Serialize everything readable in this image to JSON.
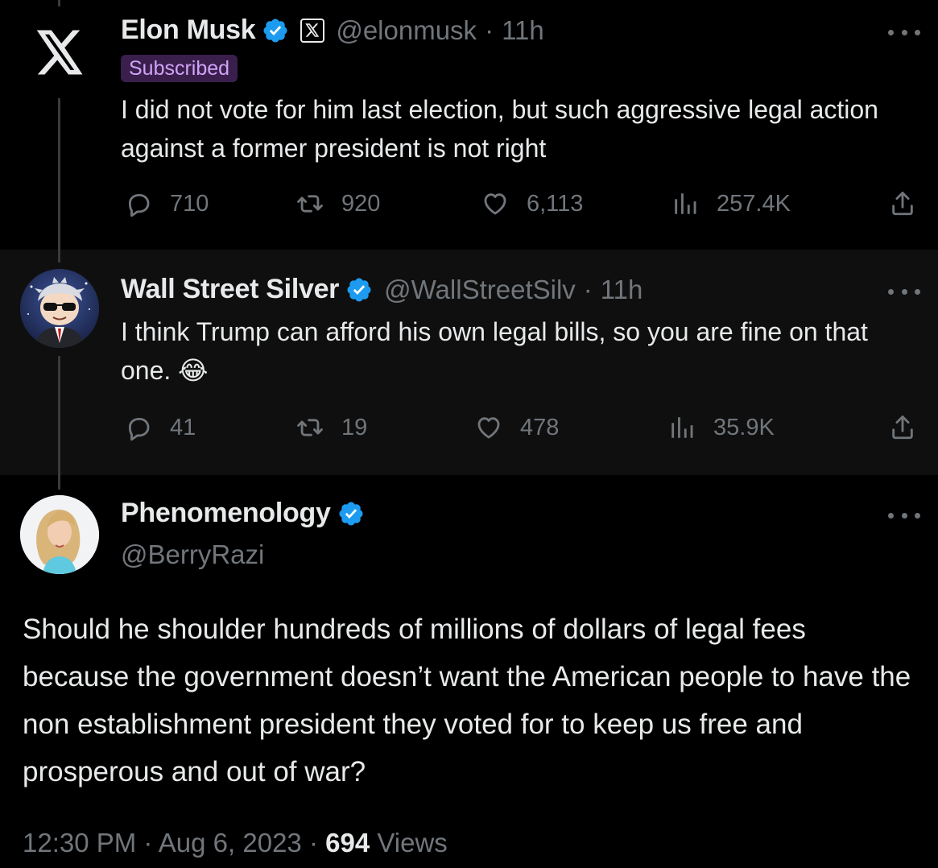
{
  "tweet1": {
    "name": "Elon Musk",
    "handle": "@elonmusk",
    "sep": "·",
    "time": "11h",
    "badge": "Subscribed",
    "text": "I did not vote for him last election, but such aggressive legal action against a former president is not right",
    "replies": "710",
    "reposts": "920",
    "likes": "6,113",
    "views": "257.4K"
  },
  "tweet2": {
    "name": "Wall Street Silver",
    "handle": "@WallStreetSilv",
    "sep": "·",
    "time": "11h",
    "text": "I think Trump can afford his own legal bills, so you are fine on that one. 😂",
    "replies": "41",
    "reposts": "19",
    "likes": "478",
    "views": "35.9K"
  },
  "tweet3": {
    "name": "Phenomenology",
    "handle": "@BerryRazi",
    "text": "Should he shoulder hundreds of millions of dollars of legal fees because the government doesn’t want the American people to have the non establishment president they voted for to keep us free and prosperous and out of war?",
    "time": "12:30 PM",
    "sep": "·",
    "date": "Aug 6, 2023",
    "views_count": "694",
    "views_label": "Views"
  },
  "icons": {
    "verified_color": "#1d9bf0",
    "x_logo": "x-logo-icon",
    "reply": "reply-icon",
    "repost": "repost-icon",
    "like": "heart-icon",
    "views": "views-icon",
    "share": "share-icon"
  }
}
